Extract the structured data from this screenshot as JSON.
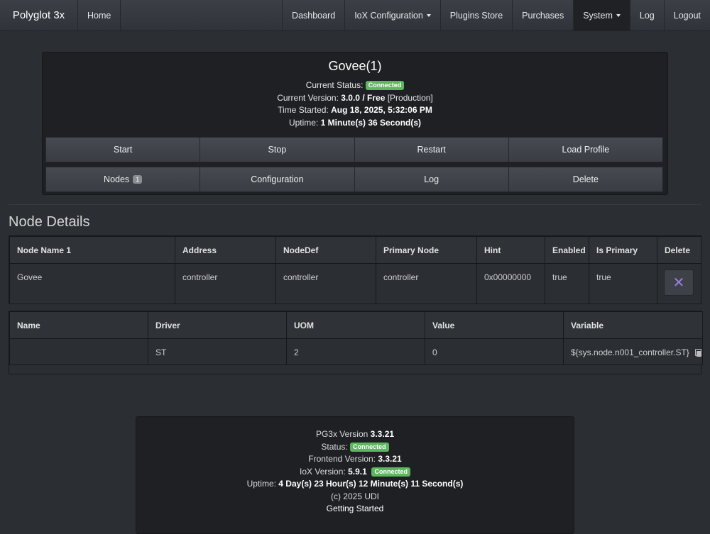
{
  "navbar": {
    "brand": "Polyglot 3x",
    "home": "Home",
    "right": [
      "Dashboard",
      "IoX Configuration",
      "Plugins Store",
      "Purchases",
      "System",
      "Log",
      "Logout"
    ]
  },
  "plugin": {
    "title": "Govee(1)",
    "status_label": "Current Status:",
    "status": "Connected",
    "version_label": "Current Version:",
    "version": "3.0.0",
    "sep": "/",
    "license": "Free",
    "channel": "[Production]",
    "started_label": "Time Started:",
    "started": "Aug 18, 2025, 5:32:06 PM",
    "uptime_label": "Uptime:",
    "uptime": "1 Minute(s) 36 Second(s)",
    "buttons_row1": [
      "Start",
      "Stop",
      "Restart",
      "Load Profile"
    ],
    "nodes_label": "Nodes",
    "nodes_count": "1",
    "buttons_row2": [
      "Configuration",
      "Log",
      "Delete"
    ]
  },
  "node_details": {
    "title": "Node Details",
    "headers": [
      "Node Name 1",
      "Address",
      "NodeDef",
      "Primary Node",
      "Hint",
      "Enabled",
      "Is Primary",
      "Delete"
    ],
    "row": [
      "Govee",
      "controller",
      "controller",
      "controller",
      "0x00000000",
      "true",
      "true"
    ],
    "delete_icon": "close-icon"
  },
  "drivers": {
    "headers": [
      "Name",
      "Driver",
      "UOM",
      "Value",
      "Variable"
    ],
    "row": [
      "",
      "ST",
      "2",
      "0",
      "${sys.node.n001_controller.ST}"
    ],
    "copy_icon": "copy-icon"
  },
  "footer": {
    "pg3x_label": "PG3x Version",
    "pg3x_version": "3.3.21",
    "status_label": "Status:",
    "status": "Connected",
    "frontend_label": "Frontend Version:",
    "frontend_version": "3.3.21",
    "iox_label": "IoX Version:",
    "iox_version": "5.9.1",
    "iox_status": "Connected",
    "uptime_label": "Uptime:",
    "uptime": "4 Day(s) 23 Hour(s) 12 Minute(s) 11 Second(s)",
    "copyright": "(c) 2025 UDI",
    "getting_started": "Getting Started"
  }
}
